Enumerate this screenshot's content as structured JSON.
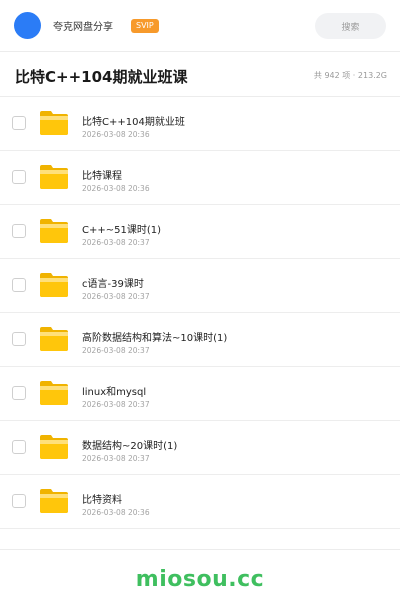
{
  "topbar": {
    "username": "夸克网盘分享",
    "badge": "SVIP",
    "search_placeholder": "搜索"
  },
  "header": {
    "title": "比特C++104期就业班课",
    "stats": "共 942 项 · 213.2G"
  },
  "files": [
    {
      "name": "比特C++104期就业班",
      "date": "2026-03-08 20:36",
      "icon": "folder-icon"
    },
    {
      "name": "比特课程",
      "date": "2026-03-08 20:36",
      "icon": "folder-icon"
    },
    {
      "name": "C++~51课时(1)",
      "date": "2026-03-08 20:37",
      "icon": "folder-icon"
    },
    {
      "name": "c语言-39课时",
      "date": "2026-03-08 20:37",
      "icon": "folder-icon"
    },
    {
      "name": "高阶数据结构和算法~10课时(1)",
      "date": "2026-03-08 20:37",
      "icon": "folder-icon"
    },
    {
      "name": "linux和mysql",
      "date": "2026-03-08 20:37",
      "icon": "folder-icon"
    },
    {
      "name": "数据结构~20课时(1)",
      "date": "2026-03-08 20:37",
      "icon": "folder-icon"
    },
    {
      "name": "比特资料",
      "date": "2026-03-08 20:36",
      "icon": "folder-icon"
    }
  ],
  "watermark": "miosou.cc",
  "colors": {
    "avatar": "#2b7cf6",
    "badge": "#f79a2b",
    "folder": "#ffc60b",
    "watermark": "#3fbf5f"
  }
}
